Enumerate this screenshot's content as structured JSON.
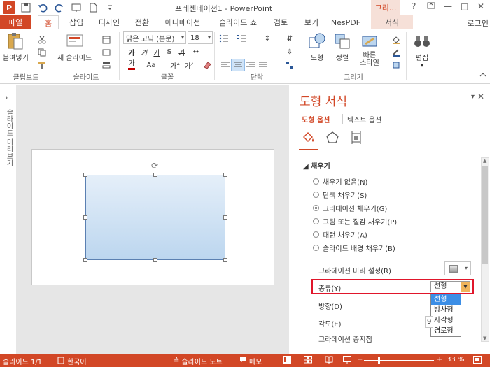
{
  "titlebar": {
    "app_logo": "P",
    "window_title": "프레젠테이션1 - PowerPoint",
    "context_tab": "그리...",
    "help": "?",
    "minimize": "—",
    "restore": "□",
    "close": "✕"
  },
  "tabs": [
    {
      "label": "파일"
    },
    {
      "label": "홈"
    },
    {
      "label": "삽입"
    },
    {
      "label": "디자인"
    },
    {
      "label": "전환"
    },
    {
      "label": "애니메이션"
    },
    {
      "label": "슬라이드 쇼"
    },
    {
      "label": "검토"
    },
    {
      "label": "보기"
    },
    {
      "label": "NesPDF"
    },
    {
      "label": "서식"
    }
  ],
  "login": "로그인",
  "ribbon": {
    "clipboard": {
      "label": "클립보드",
      "paste": "붙여넣기"
    },
    "slides": {
      "label": "슬라이드",
      "new_slide": "새 슬라이드"
    },
    "font": {
      "label": "글꼴",
      "font_name": "맑은 고딕 (본문)",
      "font_size": "18"
    },
    "paragraph": {
      "label": "단락"
    },
    "drawing": {
      "label": "그리기",
      "shapes": "도형",
      "arrange": "정렬",
      "quick_styles": "빠른\n스타일"
    },
    "editing": {
      "label": "편집",
      "edit": "편집"
    }
  },
  "left_strip": {
    "chevron": "›",
    "label": "슬라이드 미리보기"
  },
  "pane": {
    "title": "도형 서식",
    "tab_shape": "도형 옵션",
    "tab_text": "텍스트 옵션",
    "section_fill": "채우기",
    "fill_options": [
      {
        "label": "채우기 없음(N)",
        "checked": false
      },
      {
        "label": "단색 채우기(S)",
        "checked": false
      },
      {
        "label": "그라데이션 채우기(G)",
        "checked": true
      },
      {
        "label": "그림 또는 질감 채우기(P)",
        "checked": false
      },
      {
        "label": "패턴 채우기(A)",
        "checked": false
      },
      {
        "label": "슬라이드 배경 채우기(B)",
        "checked": false
      }
    ],
    "preset_label": "그라데이션 미리 설정(R)",
    "type_label": "종류(Y)",
    "type_value": "선형",
    "type_options": [
      {
        "label": "선형",
        "selected": true
      },
      {
        "label": "방사형",
        "selected": false
      },
      {
        "label": "사각형",
        "selected": false
      },
      {
        "label": "경로형",
        "selected": false
      }
    ],
    "direction_label": "방향(D)",
    "angle_label": "각도(E)",
    "angle_value": "9",
    "stops_label": "그라데이션 중지점"
  },
  "status": {
    "slide_info": "슬라이드 1/1",
    "language": "한국어",
    "notes": "슬라이드 노트",
    "comments": "메모",
    "zoom": "33 %"
  },
  "colors": {
    "accent": "#d24726",
    "selected_option": "#3b8ee6",
    "highlight_box": "#e0162b"
  }
}
